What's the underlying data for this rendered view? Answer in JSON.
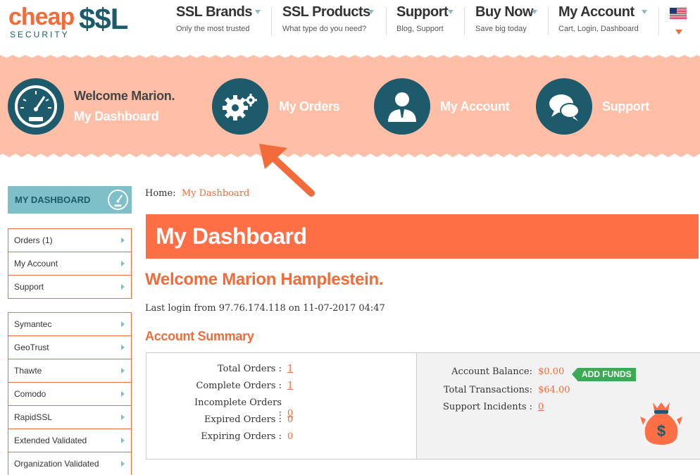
{
  "logo": {
    "word1": "cheap",
    "word2": "$$L",
    "tagline": "SECURITY"
  },
  "nav": [
    {
      "title": "SSL Brands",
      "sub": "Only the most trusted"
    },
    {
      "title": "SSL Products",
      "sub": "What type do you need?"
    },
    {
      "title": "Support",
      "sub": "Blog, Support"
    },
    {
      "title": "Buy Now",
      "sub": "Save big today"
    },
    {
      "title": "My Account",
      "sub": "Cart, Login, Dashboard"
    }
  ],
  "band": {
    "welcome": "Welcome Marion.",
    "dashboard": "My Dashboard",
    "orders": "My Orders",
    "account": "My Account",
    "support": "Support"
  },
  "sidebar": {
    "heading": "MY DASHBOARD",
    "group1": [
      "Orders (1)",
      "My Account",
      "Support"
    ],
    "group2": [
      "Symantec",
      "GeoTrust",
      "Thawte",
      "Comodo",
      "RapidSSL",
      "Extended Validated",
      "Organization Validated"
    ]
  },
  "breadcrumb": {
    "home": "Home",
    "sep": ":",
    "current": "My Dashboard"
  },
  "page_title": "My Dashboard",
  "welcome": "Welcome Marion Hamplestein.",
  "last_login": "Last login from 97.76.174.118 on 11-07-2017 04:47",
  "summary": {
    "heading": "Account Summary",
    "orders": [
      {
        "label": "Total Orders :",
        "value": "1"
      },
      {
        "label": "Complete Orders :",
        "value": "1"
      },
      {
        "label": "Incomplete Orders :",
        "value": "0"
      },
      {
        "label": "Expired Orders :",
        "value": "0"
      },
      {
        "label": "Expiring Orders :",
        "value": "0"
      }
    ],
    "balance_label": "Account Balance:",
    "balance_value": "$0.00",
    "add_funds": "ADD FUNDS",
    "transactions_label": "Total Transactions:",
    "transactions_value": "$64.00",
    "incidents_label": "Support Incidents :",
    "incidents_value": "0"
  },
  "colors": {
    "accent": "#f26b3a",
    "teal": "#1d5a6b",
    "band": "#ffbfa6",
    "green": "#3aaa55"
  }
}
